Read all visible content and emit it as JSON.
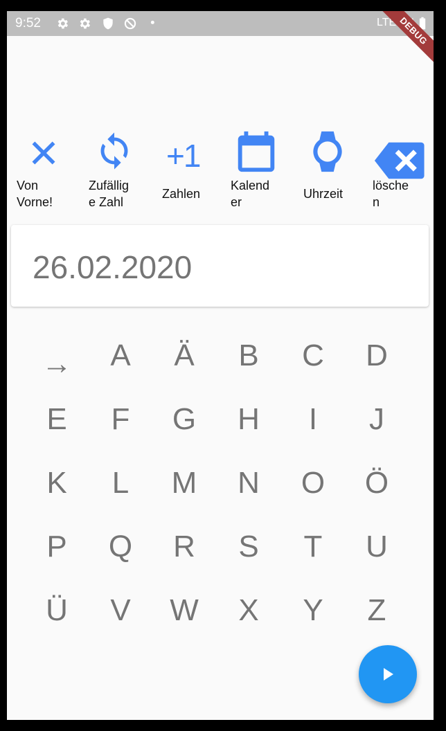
{
  "status_bar": {
    "time": "9:52",
    "network": "LTE",
    "icons": [
      "settings-icon",
      "settings-icon",
      "shield-icon",
      "sync-disabled-icon",
      "dot-icon",
      "signal-icon",
      "battery-icon"
    ]
  },
  "debug_banner": "DEBUG",
  "toolbar": {
    "accent_color": "#4285f4",
    "items": [
      {
        "label": "Von\nVorne!",
        "icon": "close-icon"
      },
      {
        "label": "Zufällig\ne Zahl",
        "icon": "refresh-icon"
      },
      {
        "label": "Zahlen",
        "icon": "plus-one-icon",
        "icon_text": "+1"
      },
      {
        "label": "Kalend er",
        "label_lines": "Kalend\ner",
        "icon": "calendar-icon"
      },
      {
        "label": "Uhrzeit",
        "icon": "watch-icon"
      },
      {
        "label": "lösche\nn",
        "icon": "backspace-icon"
      }
    ]
  },
  "display": {
    "value": "26.02.2020"
  },
  "keypad": {
    "rows": [
      [
        "→",
        "A",
        "Ä",
        "B",
        "C",
        "D"
      ],
      [
        "E",
        "F",
        "G",
        "H",
        "I",
        "J"
      ],
      [
        "K",
        "L",
        "M",
        "N",
        "O",
        "Ö"
      ],
      [
        "P",
        "Q",
        "R",
        "S",
        "T",
        "U"
      ],
      [
        "Ü",
        "V",
        "W",
        "X",
        "Y",
        "Z"
      ]
    ]
  },
  "fab": {
    "icon": "play-icon",
    "color": "#2196f3"
  }
}
